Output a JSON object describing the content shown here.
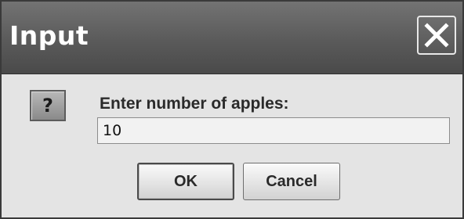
{
  "dialog": {
    "title": "Input",
    "close_icon": "close-icon",
    "question_icon": "question-icon",
    "question_glyph": "?",
    "prompt": "Enter number of apples:",
    "input_value": "10",
    "ok_label": "OK",
    "cancel_label": "Cancel"
  }
}
